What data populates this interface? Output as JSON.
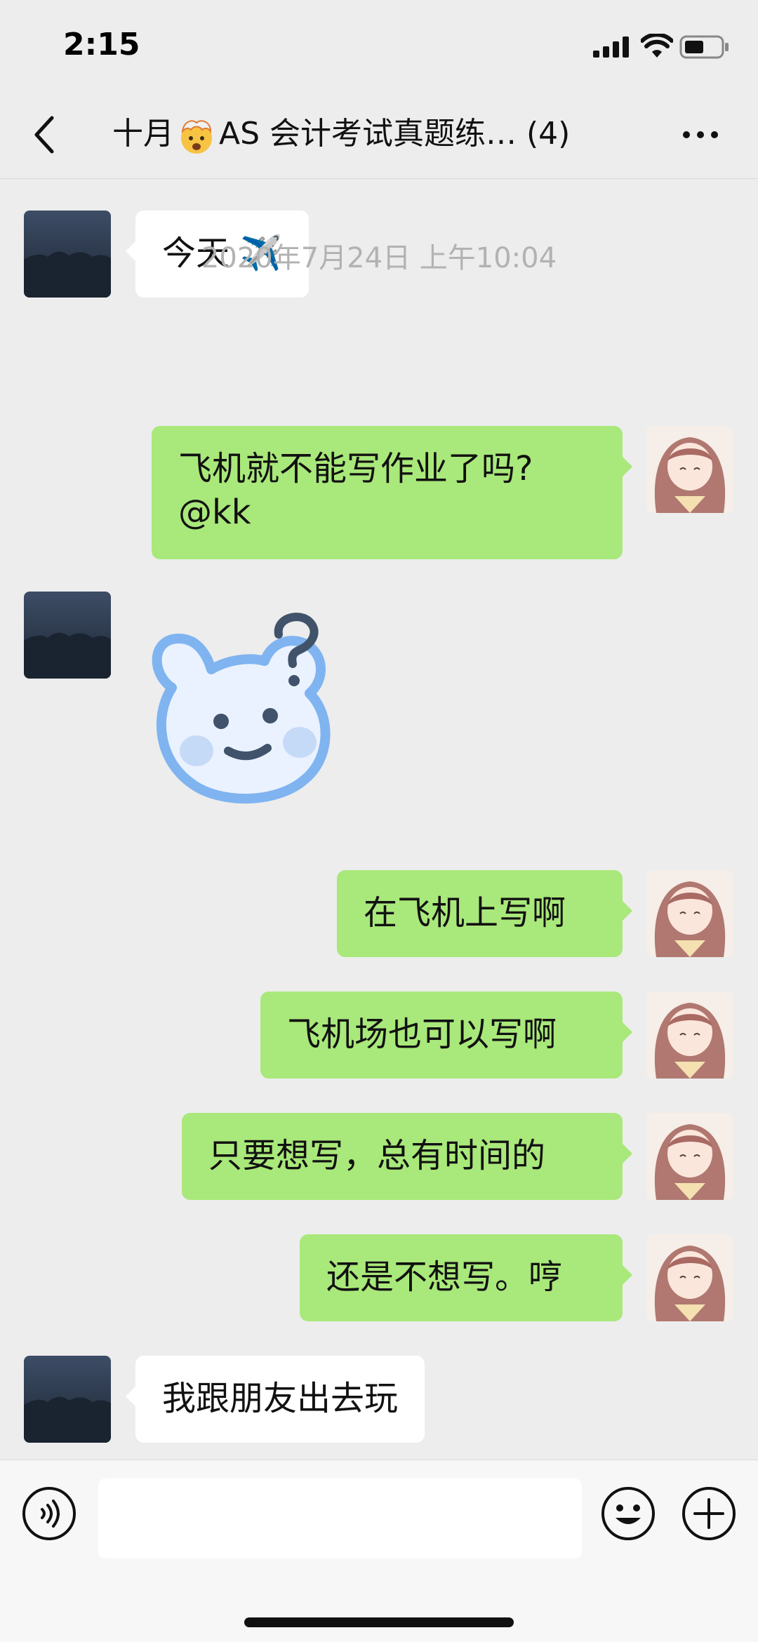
{
  "status": {
    "time": "2:15"
  },
  "header": {
    "title_part1": "十月",
    "title_part2": "AS 会计考试真题练…",
    "member_count": "(4)"
  },
  "messages": [
    {
      "id": "m1",
      "direction": "in",
      "text": "今天 ✈️",
      "avatar": "night-landscape"
    },
    {
      "id": "ts1",
      "type": "timestamp",
      "text": "2020年7月24日 上午10:04"
    },
    {
      "id": "m2",
      "direction": "out",
      "text": "飞机就不能写作业了吗?\n@kk",
      "avatar": "anime-girl"
    },
    {
      "id": "m3",
      "direction": "in",
      "type": "sticker",
      "sticker": "confused-bear-question",
      "avatar": "night-landscape"
    },
    {
      "id": "m4",
      "direction": "out",
      "text": "在飞机上写啊",
      "avatar": "anime-girl"
    },
    {
      "id": "m5",
      "direction": "out",
      "text": "飞机场也可以写啊",
      "avatar": "anime-girl"
    },
    {
      "id": "m6",
      "direction": "out",
      "text": "只要想写，总有时间的",
      "avatar": "anime-girl"
    },
    {
      "id": "m7",
      "direction": "out",
      "text": "还是不想写。哼",
      "avatar": "anime-girl"
    },
    {
      "id": "m8",
      "direction": "in",
      "text": "我跟朋友出去玩",
      "avatar": "night-landscape"
    }
  ],
  "input": {
    "value": ""
  },
  "icons": [
    "back-icon",
    "more-icon",
    "voice-icon",
    "emoji-icon",
    "plus-icon"
  ],
  "colors": {
    "background": "#ededed",
    "outgoing_bubble": "#a9e87a",
    "incoming_bubble": "#ffffff"
  }
}
